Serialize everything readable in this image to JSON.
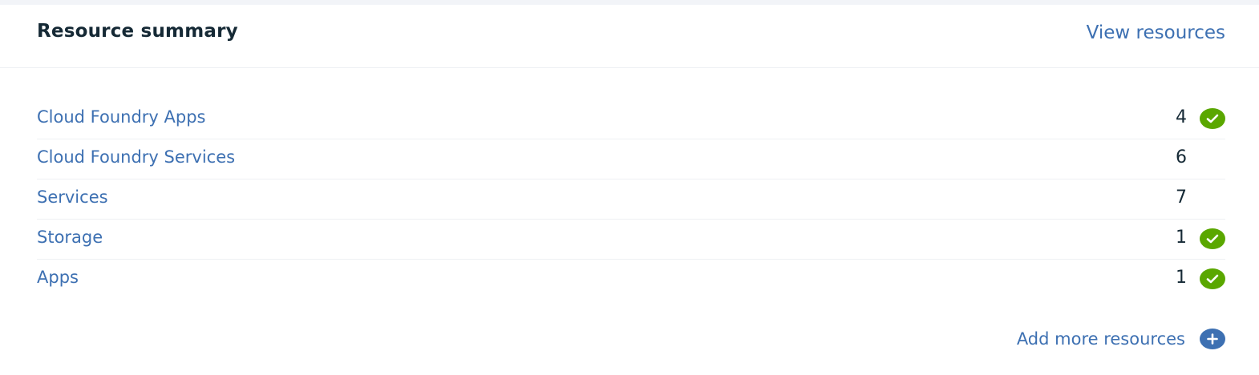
{
  "card": {
    "title": "Resource summary",
    "view_link": "View resources"
  },
  "resources": [
    {
      "name": "Cloud Foundry Apps",
      "count": "4",
      "status": "ok"
    },
    {
      "name": "Cloud Foundry Services",
      "count": "6",
      "status": "none"
    },
    {
      "name": "Services",
      "count": "7",
      "status": "none"
    },
    {
      "name": "Storage",
      "count": "1",
      "status": "ok"
    },
    {
      "name": "Apps",
      "count": "1",
      "status": "ok"
    }
  ],
  "footer": {
    "add_more_label": "Add more resources",
    "add_icon": "plus-circle-icon"
  },
  "icons": {
    "status_ok": "checkmark-circle-icon"
  },
  "colors": {
    "link": "#3d70b2",
    "title": "#152935",
    "status_ok": "#5aa700"
  }
}
